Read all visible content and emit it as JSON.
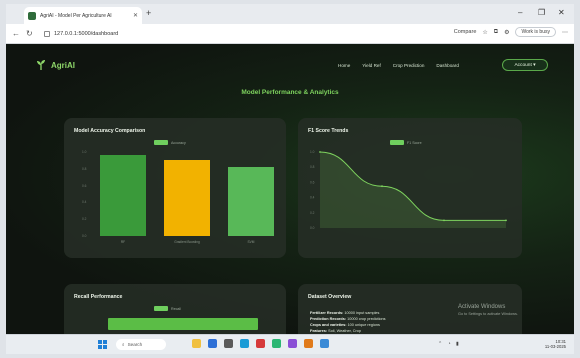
{
  "browser": {
    "tab_title": "AgriAI - Model Per Agriculture AI",
    "tab_close": "✕",
    "new_tab": "+",
    "url": "127.0.0.1:5000/dashboard",
    "compare_label": "Compare",
    "profile_label": "Work is busy",
    "window_controls": [
      "–",
      "❐",
      "✕"
    ]
  },
  "navbar": {
    "brand": "AgriAI",
    "links": [
      "Home",
      "Yield Ref",
      "Crop Prediction",
      "Dashboard"
    ],
    "account_label": "Account ▾"
  },
  "page": {
    "title": "Model Performance & Analytics"
  },
  "accuracy_card": {
    "title": "Model Accuracy Comparison",
    "legend_label": "Accuracy"
  },
  "f1_card": {
    "title": "F1 Score Trends",
    "legend_label": "F1 Score"
  },
  "recall_card": {
    "title": "Recall Performance",
    "legend_label": "Recall"
  },
  "overview_card": {
    "title": "Dataset Overview",
    "items": [
      {
        "label": "Fertilizer Records:",
        "value": "10000 input samples"
      },
      {
        "label": "Prediction Records:",
        "value": "10000 crop predictions"
      },
      {
        "label": "Crops and varieties:",
        "value": "100 unique regions"
      },
      {
        "label": "Features:",
        "value": "Soil, Weather, Crop"
      }
    ]
  },
  "watermark": {
    "line1": "Activate Windows",
    "line2": "Go to Settings to activate Windows."
  },
  "taskbar": {
    "search_label": "Search",
    "time": "10:31",
    "date": "11-03-2025",
    "tray_text": "ENG IN"
  },
  "chart_data": [
    {
      "type": "bar",
      "title": "Model Accuracy Comparison",
      "categories": [
        "RF",
        "Gradient Boosting",
        "SVM"
      ],
      "series": [
        {
          "name": "Accuracy",
          "values": [
            0.96,
            0.91,
            0.82
          ]
        }
      ],
      "ylim": [
        0,
        1.0
      ],
      "colors": [
        "#3a9a3a",
        "#f2b200",
        "#58b858"
      ],
      "legend_position": "top"
    },
    {
      "type": "line",
      "title": "F1 Score Trends",
      "x": [
        0,
        1,
        2,
        3
      ],
      "series": [
        {
          "name": "F1 Score",
          "values": [
            1.0,
            0.55,
            0.1,
            0.1
          ]
        }
      ],
      "ylim": [
        0,
        1.0
      ],
      "color": "#7ed35e",
      "legend_position": "top"
    }
  ]
}
